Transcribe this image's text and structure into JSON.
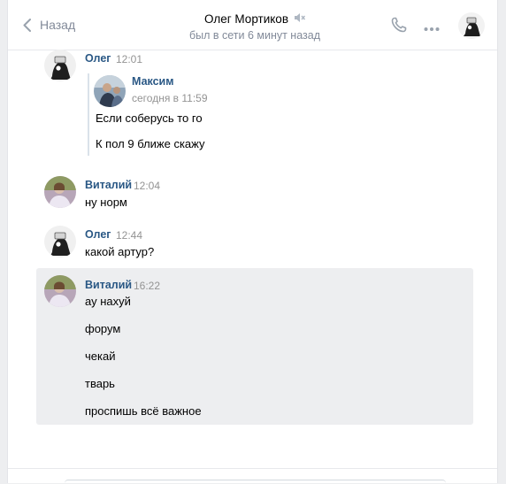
{
  "header": {
    "back_label": "Назад",
    "title": "Олег Мортиков",
    "subtitle": "был в сети 6 минут назад"
  },
  "messages": [
    {
      "author": "Олег",
      "time": "12:01",
      "forward": {
        "author": "Максим",
        "time": "сегодня в 11:59",
        "lines": [
          "Если соберусь то го",
          "К пол 9 ближе скажу"
        ]
      }
    },
    {
      "author": "Виталий",
      "time": "12:04",
      "lines": [
        "ну норм"
      ]
    },
    {
      "author": "Олег",
      "time": "12:44",
      "lines": [
        "какой артур?"
      ]
    },
    {
      "author": "Виталий",
      "time": "16:22",
      "lines": [
        "ау нахуй",
        "форум",
        "чекай",
        "тварь",
        "проспишь всё важное"
      ]
    }
  ],
  "colors": {
    "link": "#2a5885",
    "muted": "#828a99",
    "highlight": "#edeef0"
  },
  "icons": [
    "chevron-left-icon",
    "muted-speaker-icon",
    "phone-icon",
    "more-icon"
  ]
}
